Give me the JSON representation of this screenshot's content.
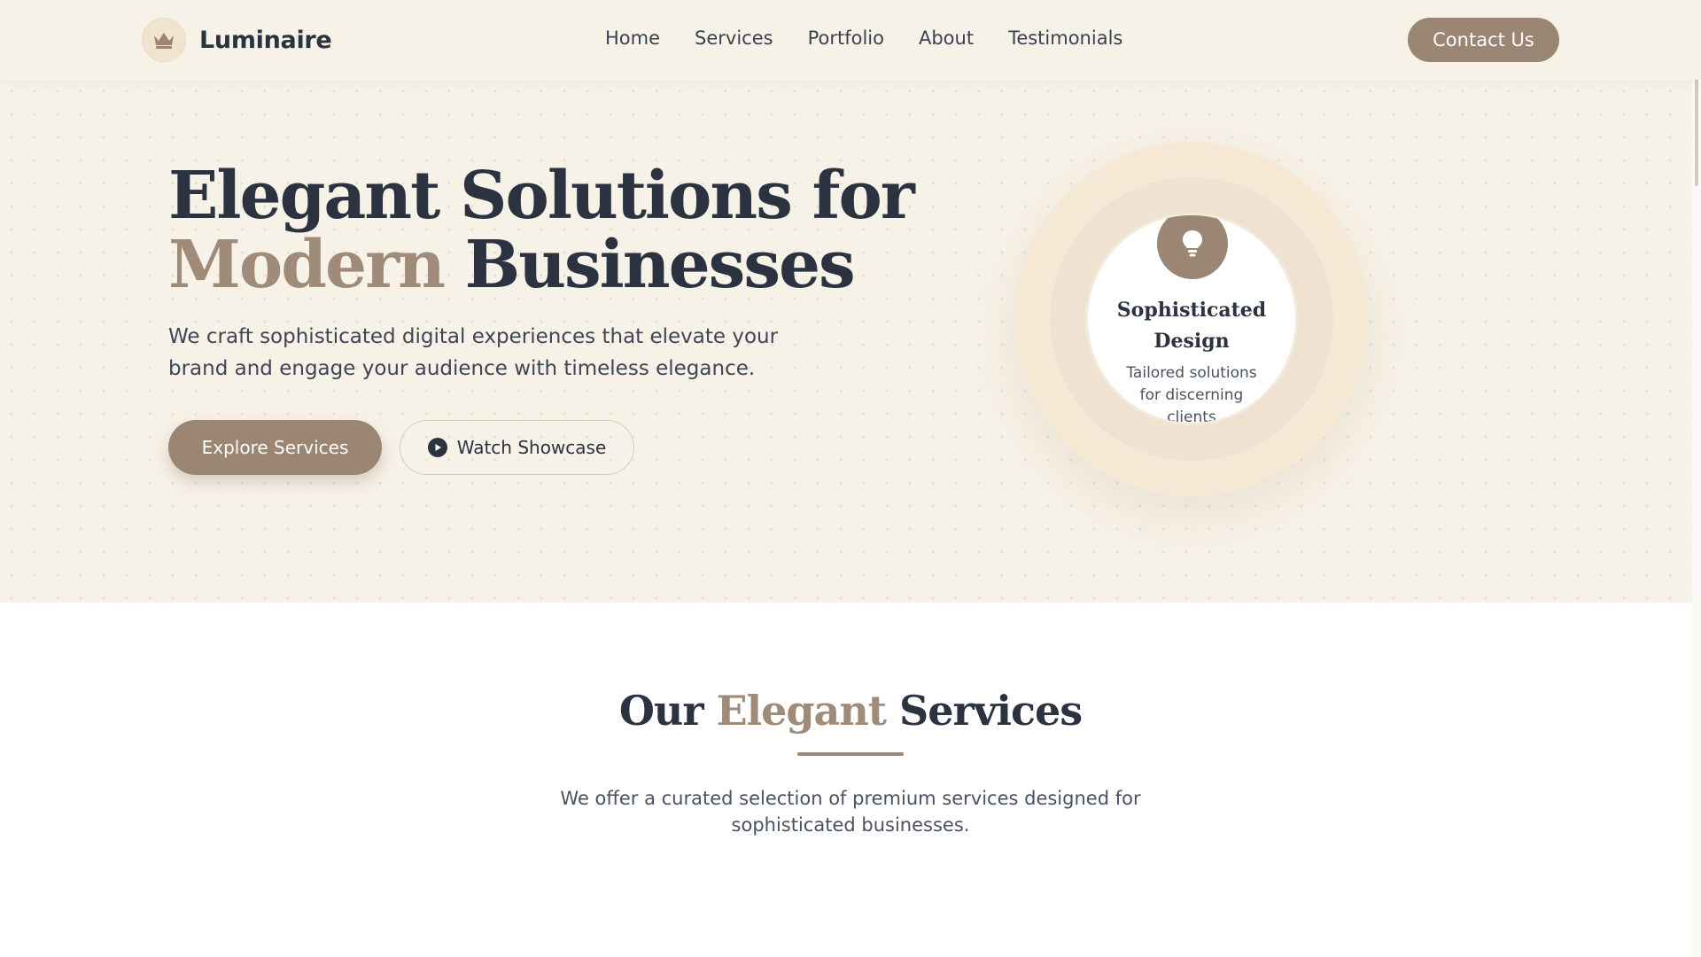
{
  "nav": {
    "brand_name": "Luminaire",
    "links": [
      "Home",
      "Services",
      "Portfolio",
      "About",
      "Testimonials"
    ],
    "cta_label": "Contact Us"
  },
  "hero": {
    "title_line1": "Elegant Solutions for",
    "title_accent": "Modern",
    "title_rest": " Businesses",
    "subtitle": "We craft sophisticated digital experiences that elevate your brand and engage your audience with timeless elegance.",
    "primary_button": "Explore Services",
    "secondary_button": "Watch Showcase",
    "feature_card": {
      "title": "Sophisticated Design",
      "text": "Tailored solutions for discerning clients"
    }
  },
  "services": {
    "title_pre": "Our ",
    "title_accent": "Elegant",
    "title_post": " Services",
    "subtitle": "We offer a curated selection of premium services designed for sophisticated businesses."
  },
  "colors": {
    "accent": "#9b8573",
    "dark": "#2b3340",
    "cream": "#f7f2e8"
  },
  "icons": [
    "crown-icon",
    "play-icon",
    "lightbulb-icon"
  ]
}
